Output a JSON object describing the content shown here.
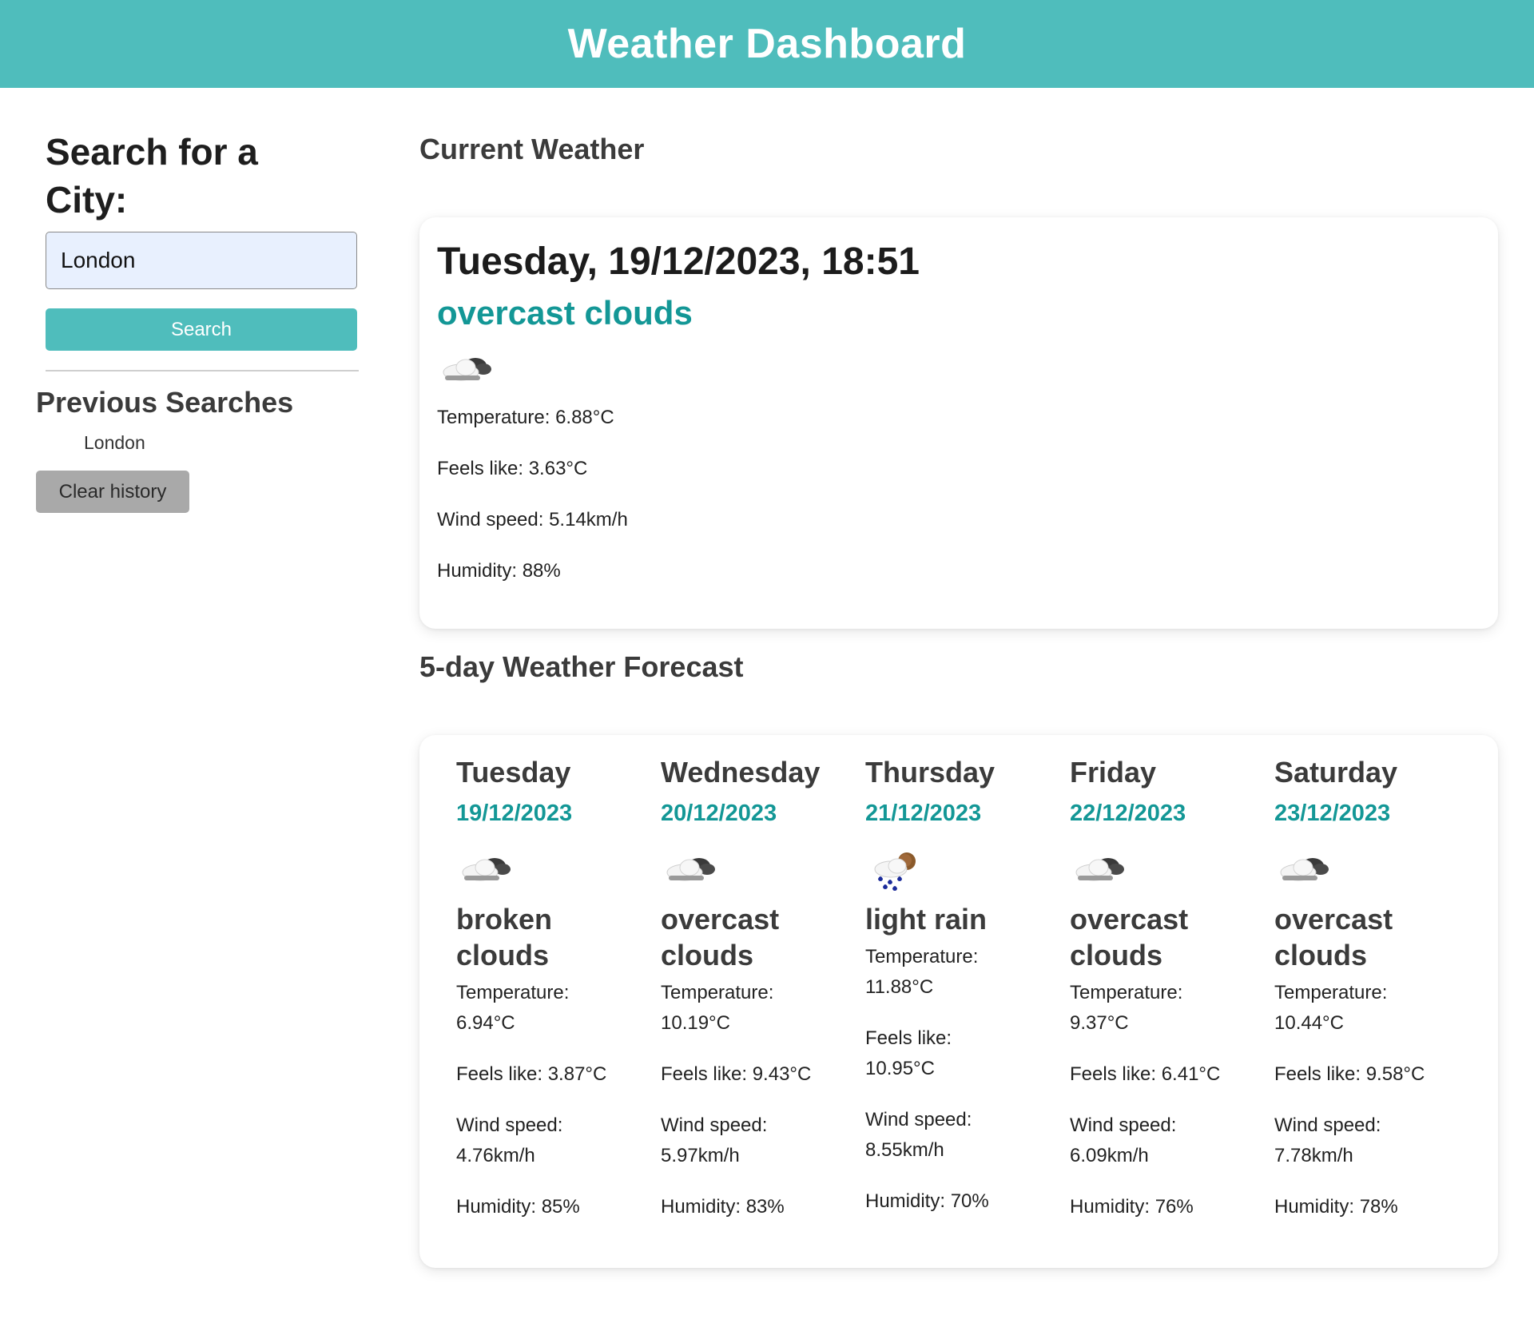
{
  "header": {
    "title": "Weather Dashboard",
    "color": "#4fbdbc"
  },
  "sidebar": {
    "heading": "Search for a City:",
    "search_value": "London",
    "search_button": "Search",
    "previous_heading": "Previous Searches",
    "history": [
      "London"
    ],
    "clear_button": "Clear history"
  },
  "current": {
    "section_title": "Current Weather",
    "datetime": "Tuesday, 19/12/2023, 18:51",
    "description": "overcast clouds",
    "icon": "overcast-clouds-icon",
    "temperature": "Temperature: 6.88°C",
    "feels_like": "Feels like: 3.63°C",
    "wind": "Wind speed: 5.14km/h",
    "humidity": "Humidity: 88%"
  },
  "forecast": {
    "section_title": "5-day Weather Forecast",
    "days": [
      {
        "day": "Tuesday",
        "date": "19/12/2023",
        "icon": "overcast-clouds-icon",
        "description": "broken clouds",
        "temperature": "Temperature: 6.94°C",
        "feels_like": "Feels like: 3.87°C",
        "wind": "Wind speed: 4.76km/h",
        "humidity": "Humidity: 85%"
      },
      {
        "day": "Wednesday",
        "date": "20/12/2023",
        "icon": "overcast-clouds-icon",
        "description": "overcast clouds",
        "temperature": "Temperature: 10.19°C",
        "feels_like": "Feels like: 9.43°C",
        "wind": "Wind speed: 5.97km/h",
        "humidity": "Humidity: 83%"
      },
      {
        "day": "Thursday",
        "date": "21/12/2023",
        "icon": "light-rain-icon",
        "description": "light rain",
        "temperature": "Temperature: 11.88°C",
        "feels_like": "Feels like: 10.95°C",
        "wind": "Wind speed: 8.55km/h",
        "humidity": "Humidity: 70%"
      },
      {
        "day": "Friday",
        "date": "22/12/2023",
        "icon": "overcast-clouds-icon",
        "description": "overcast clouds",
        "temperature": "Temperature: 9.37°C",
        "feels_like": "Feels like: 6.41°C",
        "wind": "Wind speed: 6.09km/h",
        "humidity": "Humidity: 76%"
      },
      {
        "day": "Saturday",
        "date": "23/12/2023",
        "icon": "overcast-clouds-icon",
        "description": "overcast clouds",
        "temperature": "Temperature: 10.44°C",
        "feels_like": "Feels like: 9.58°C",
        "wind": "Wind speed: 7.78km/h",
        "humidity": "Humidity: 78%"
      }
    ]
  },
  "colors": {
    "accent": "#4fbdbc",
    "description_teal": "#139796",
    "clear_button": "#a9a9a9",
    "input_bg": "#e8f0fe"
  }
}
